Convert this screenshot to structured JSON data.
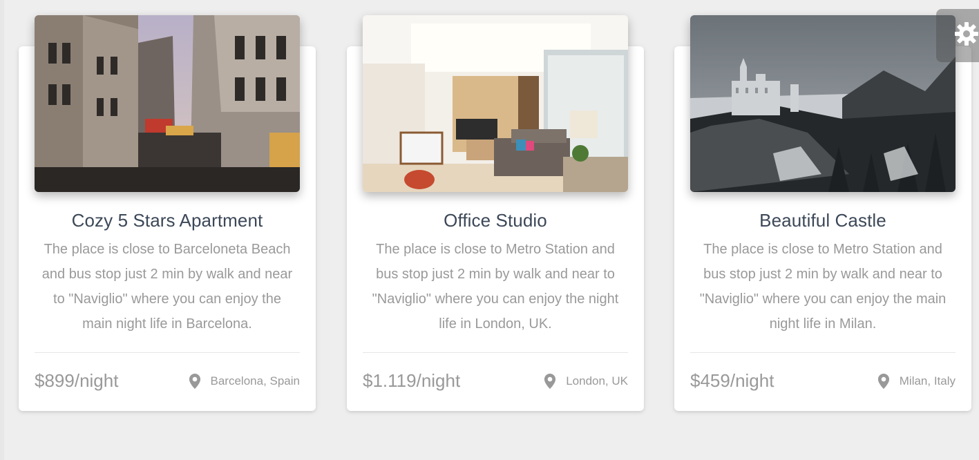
{
  "cards": [
    {
      "title": "Cozy 5 Stars Apartment",
      "description": "The place is close to Barceloneta Beach and bus stop just 2 min by walk and near to \"Naviglio\" where you can enjoy the main night life in Barcelona.",
      "price": "$899/night",
      "location": "Barcelona, Spain"
    },
    {
      "title": "Office Studio",
      "description": "The place is close to Metro Station and bus stop just 2 min by walk and near to \"Naviglio\" where you can enjoy the night life in London, UK.",
      "price": "$1.119/night",
      "location": "London, UK"
    },
    {
      "title": "Beautiful Castle",
      "description": "The place is close to Metro Station and bus stop just 2 min by walk and near to \"Naviglio\" where you can enjoy the main night life in Milan.",
      "price": "$459/night",
      "location": "Milan, Italy"
    }
  ],
  "icons": {
    "location": "map-pin-icon",
    "settings": "gear-icon"
  },
  "colors": {
    "page_background": "#eeeeee",
    "card_background": "#ffffff",
    "title_text": "#3c4858",
    "muted_text": "#999999",
    "settings_tab": "#7a7a7a"
  }
}
